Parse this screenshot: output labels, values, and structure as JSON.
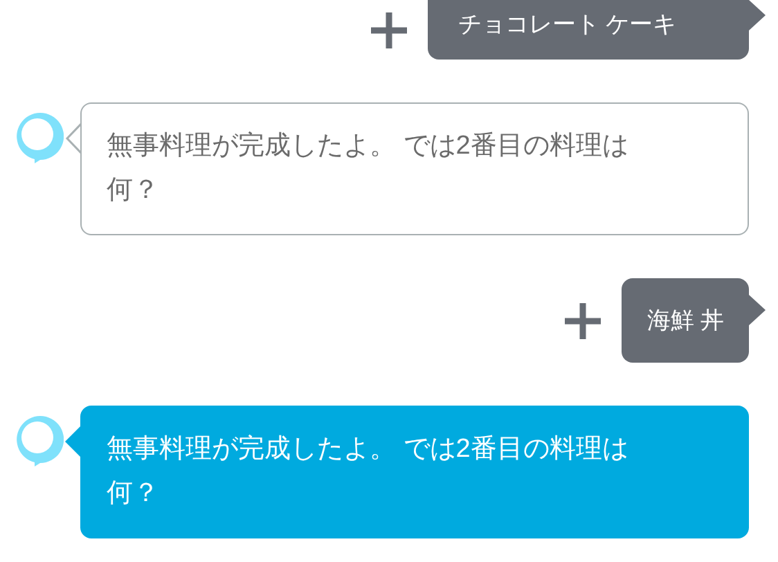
{
  "messages": [
    {
      "kind": "user",
      "text": "チョコレート ケーキ"
    },
    {
      "kind": "alexa",
      "text": "無事料理が完成したよ。 では2番目の料理は何？",
      "highlighted": false
    },
    {
      "kind": "user",
      "text": "海鮮 丼"
    },
    {
      "kind": "alexa",
      "text": "無事料理が完成したよ。 では2番目の料理は何？",
      "highlighted": true
    }
  ]
}
